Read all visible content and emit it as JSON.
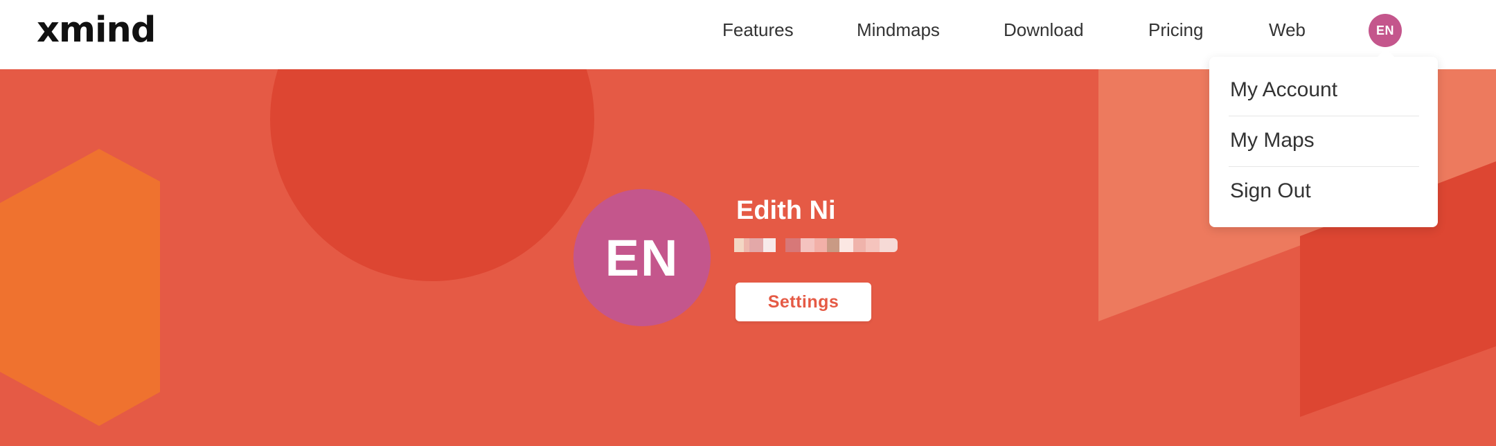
{
  "brand": {
    "logo_text": "xmind"
  },
  "nav": {
    "links": [
      {
        "label": "Features"
      },
      {
        "label": "Mindmaps"
      },
      {
        "label": "Download"
      },
      {
        "label": "Pricing"
      },
      {
        "label": "Web"
      }
    ],
    "avatar_initials": "EN"
  },
  "dropdown": {
    "items": [
      {
        "label": "My Account"
      },
      {
        "label": "My Maps"
      },
      {
        "label": "Sign Out"
      }
    ]
  },
  "profile": {
    "initials": "EN",
    "name": "Edith Ni",
    "email_state": "redacted",
    "settings_label": "Settings"
  },
  "colors": {
    "hero_background": "#e55a45",
    "circle_dark": "#dd4632",
    "panel_light": "#ed7a5e",
    "hexagon_orange": "#ef722f",
    "avatar": "#c4568c",
    "accent_text": "#e55a45"
  }
}
